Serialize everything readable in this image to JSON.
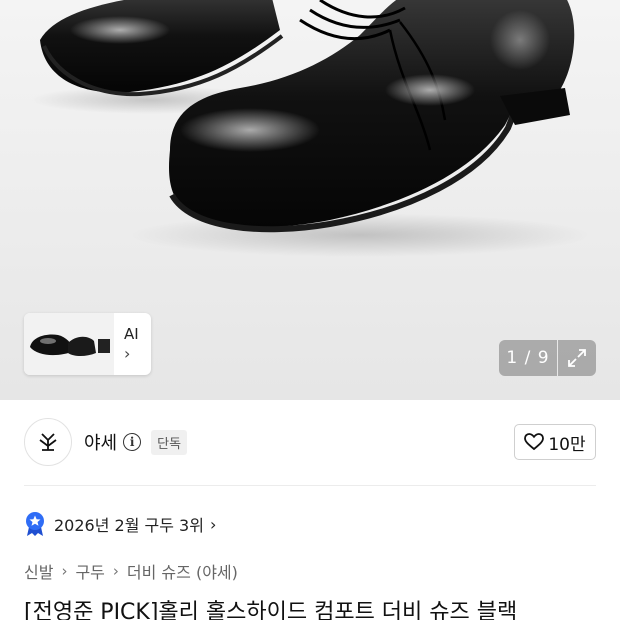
{
  "gallery": {
    "ai_label": "AI",
    "ai_chevron": "›",
    "page_indicator": "1 / 9",
    "expand_icon": "expand-icon"
  },
  "seller": {
    "name": "야세",
    "info_glyph": "i",
    "badge": "단독",
    "likes": "10만",
    "logo_icon": "seller-logo-icon",
    "heart_icon": "heart-icon"
  },
  "ranking": {
    "text": "2026년 2월 구두 3위",
    "chevron": "›",
    "icon": "rank-medal-icon"
  },
  "breadcrumb": {
    "items": [
      "신발",
      "구두",
      "더비 슈즈 (야세)"
    ],
    "separator": "›"
  },
  "product": {
    "title": "[전영준 PICK]홀리 홀스하이드 컴포트 더비 슈즈 블랙"
  },
  "colors": {
    "accent_blue": "#2f6df6",
    "text": "#111111",
    "muted": "#666666"
  }
}
